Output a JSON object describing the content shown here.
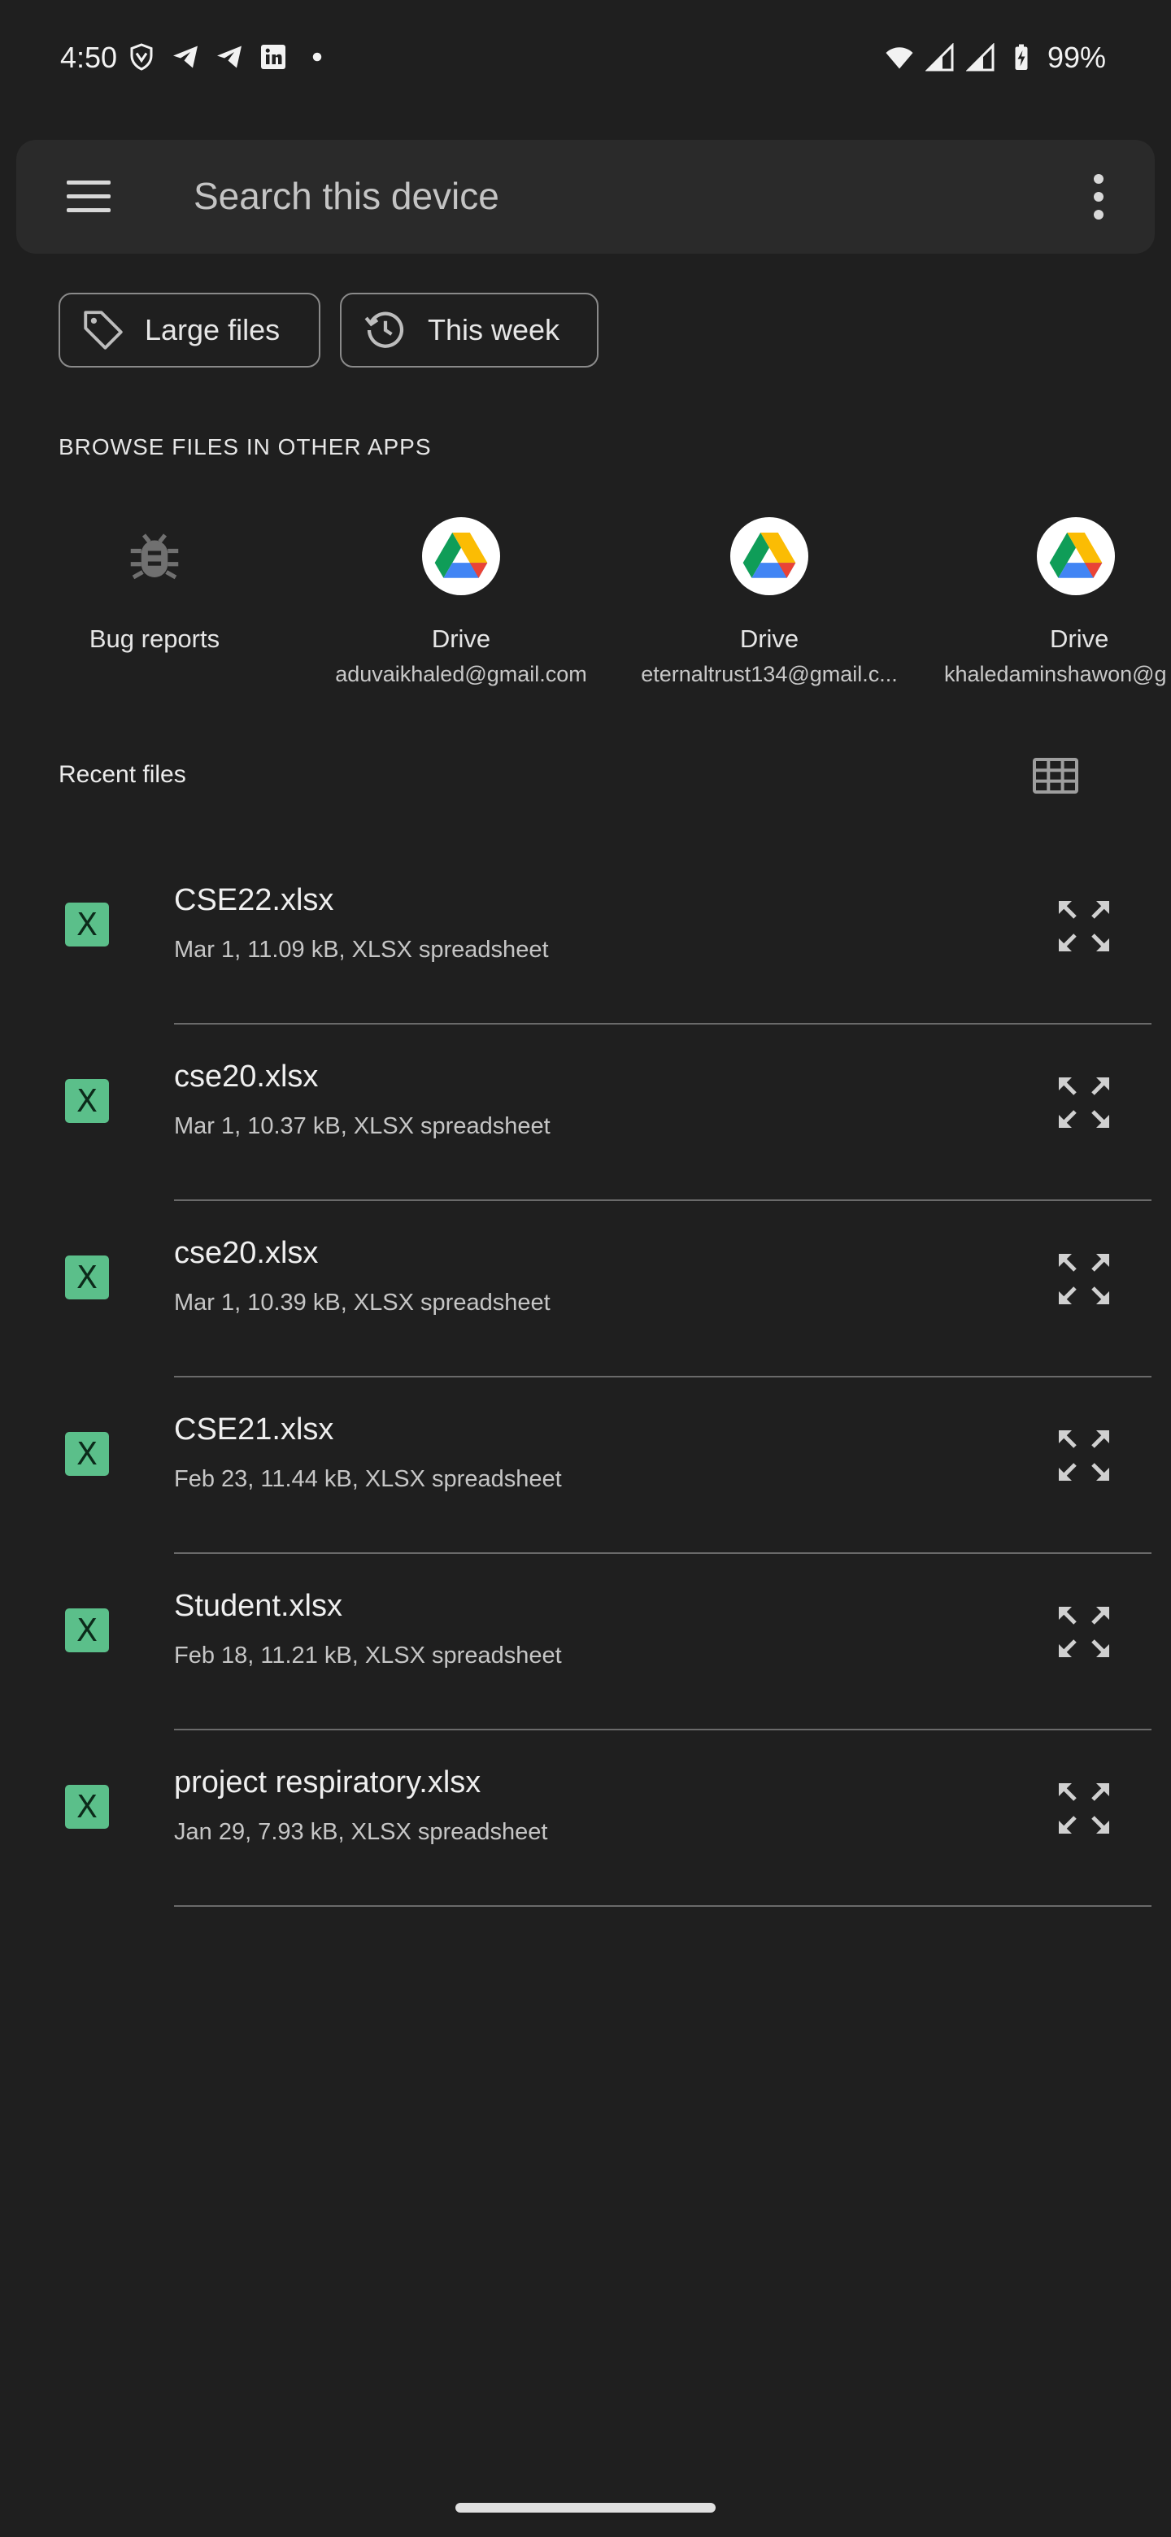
{
  "status_bar": {
    "time": "4:50",
    "battery": "99%",
    "notification_icons": [
      "vpn-shield-icon",
      "telegram-icon",
      "telegram-icon",
      "linkedin-icon",
      "dot-icon"
    ]
  },
  "search": {
    "placeholder": "Search this device"
  },
  "chips": [
    {
      "label": "Large files",
      "icon": "tag-icon"
    },
    {
      "label": "This week",
      "icon": "history-icon"
    }
  ],
  "browse": {
    "heading": "BROWSE FILES IN OTHER APPS",
    "apps": [
      {
        "name": "Bug reports",
        "account": "",
        "icon": "bug-icon"
      },
      {
        "name": "Drive",
        "account": "aduvaikhaled@gmail.com",
        "icon": "drive-icon"
      },
      {
        "name": "Drive",
        "account": "eternaltrust134@gmail.c...",
        "icon": "drive-icon"
      },
      {
        "name": "Drive",
        "account": "khaledaminshawon@g",
        "icon": "drive-icon"
      }
    ]
  },
  "recent": {
    "heading": "Recent files",
    "files": [
      {
        "name": "CSE22.xlsx",
        "meta": "Mar 1, 11.09 kB, XLSX spreadsheet"
      },
      {
        "name": "cse20.xlsx",
        "meta": "Mar 1, 10.37 kB, XLSX spreadsheet"
      },
      {
        "name": "cse20.xlsx",
        "meta": "Mar 1, 10.39 kB, XLSX spreadsheet"
      },
      {
        "name": "CSE21.xlsx",
        "meta": "Feb 23, 11.44 kB, XLSX spreadsheet"
      },
      {
        "name": "Student.xlsx",
        "meta": "Feb 18, 11.21 kB, XLSX spreadsheet"
      },
      {
        "name": "project respiratory.xlsx",
        "meta": "Jan 29, 7.93 kB, XLSX spreadsheet"
      }
    ],
    "file_icon_letter": "X"
  },
  "colors": {
    "background": "#1f1f1f",
    "search_bg": "#2a2a2a",
    "xlsx_icon": "#5bbf8a"
  }
}
